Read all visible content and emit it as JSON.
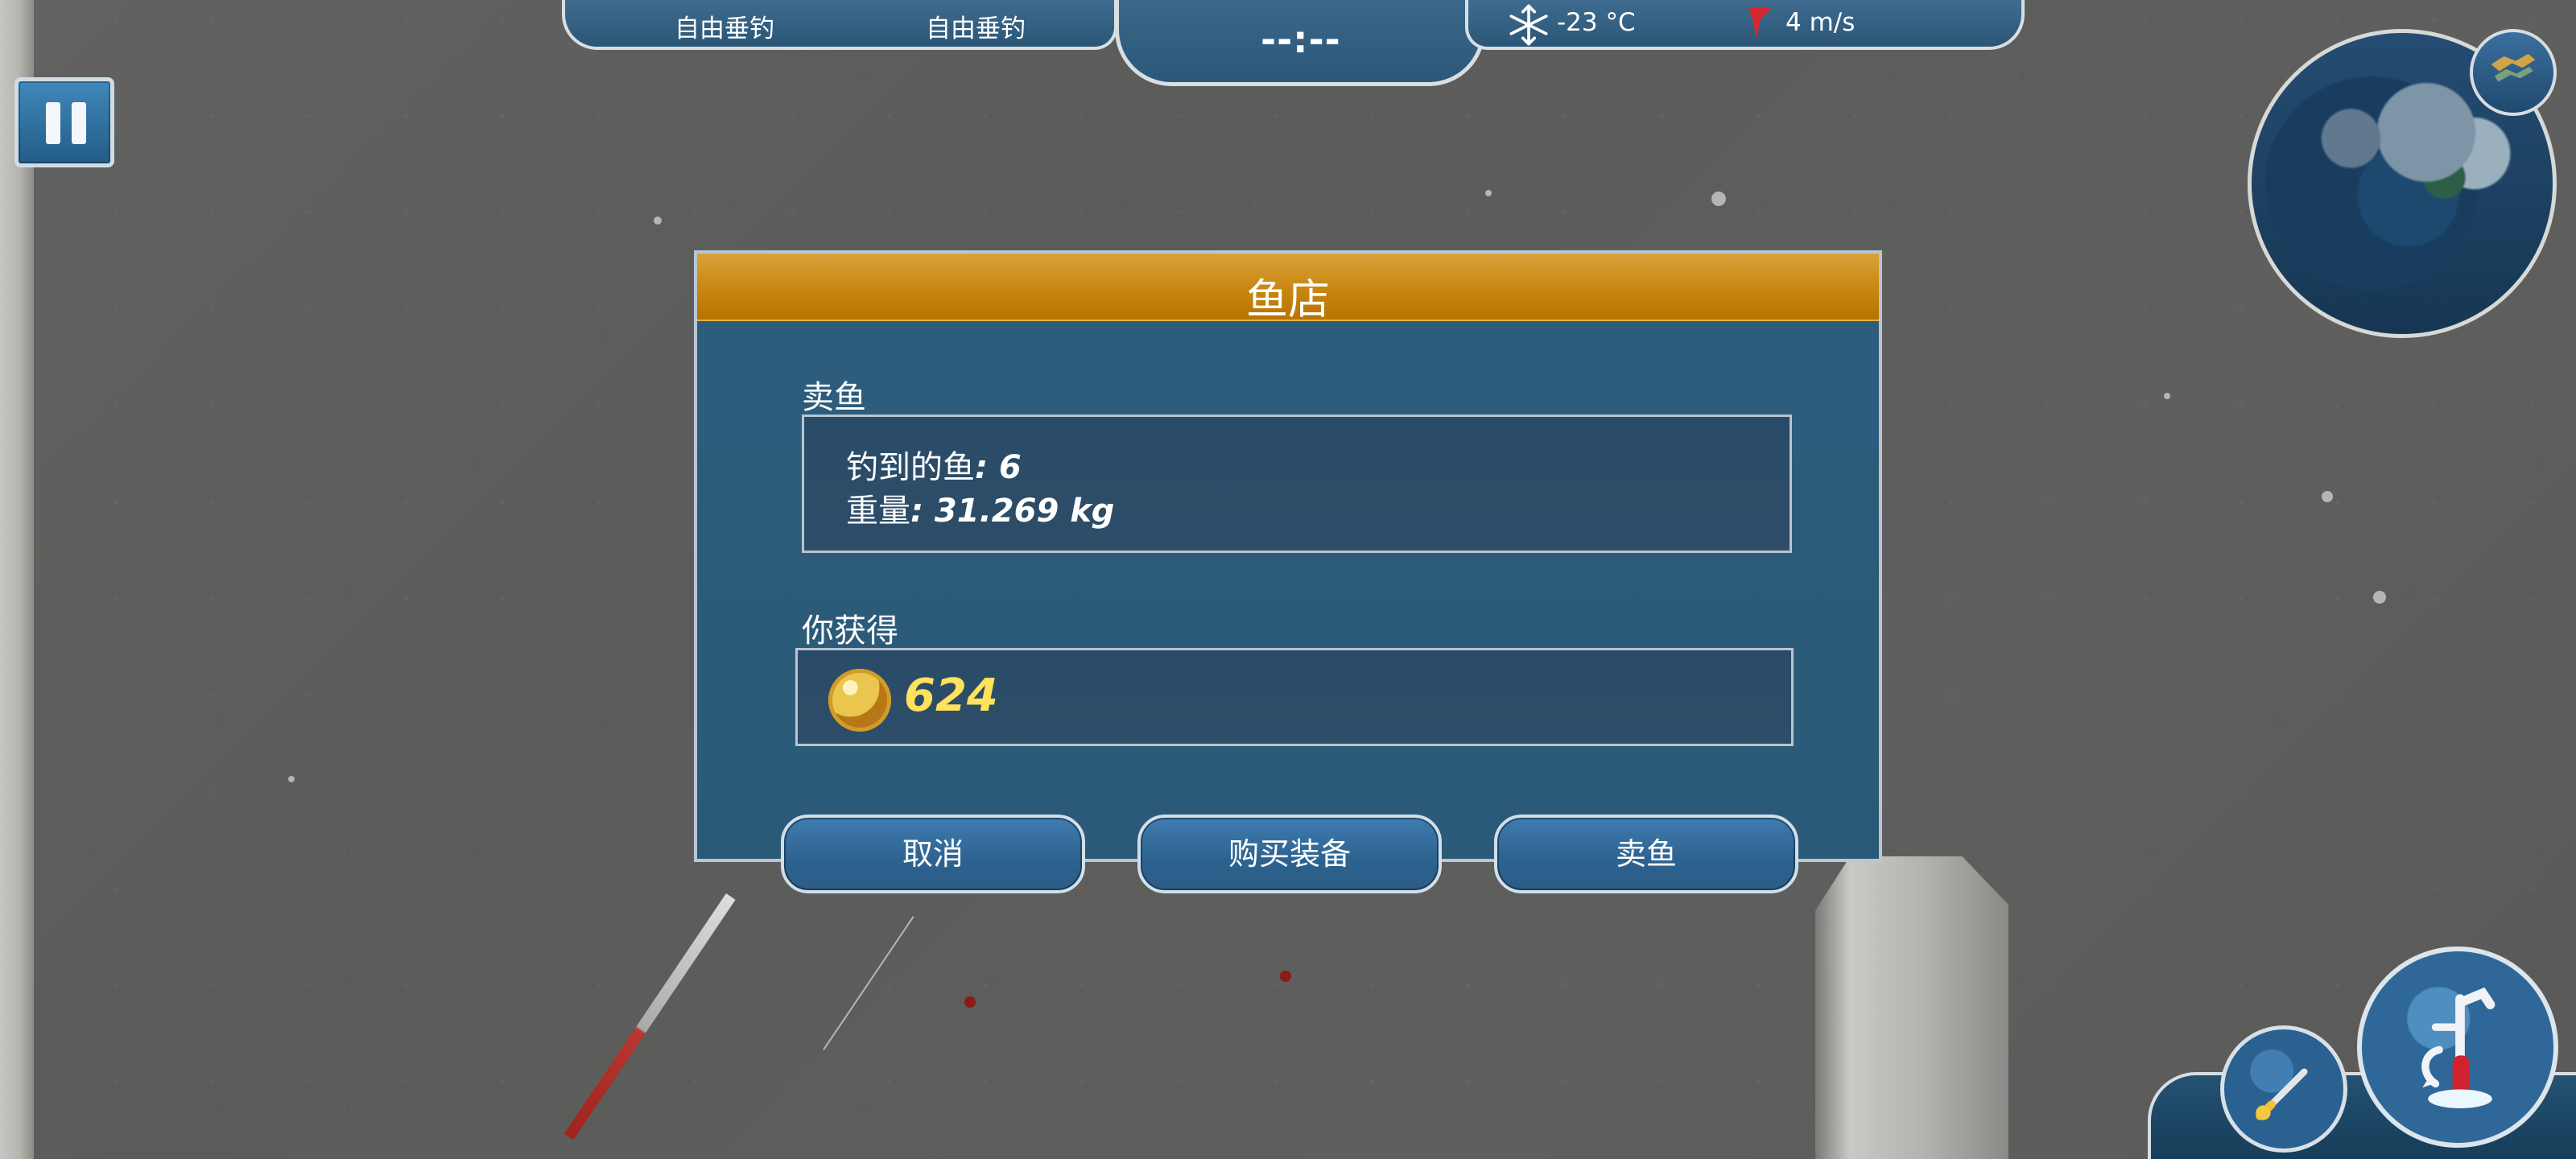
{
  "hud": {
    "mode_left": "自由垂钓",
    "mode_right": "自由垂钓",
    "clock": "--:--",
    "temperature": "-23 °C",
    "wind": "4 m/s",
    "snow_icon": "snowflake-icon",
    "wind_icon": "wind-arrow-icon"
  },
  "controls": {
    "pause_icon": "pause-icon",
    "map_icon": "map-icon",
    "small_tool_icon": "fishing-rod-icon",
    "large_tool_icon": "ice-drill-icon"
  },
  "dialog": {
    "title": "鱼店",
    "sell_section_label": "卖鱼",
    "fish_caught_label": "钓到的鱼",
    "fish_caught_value": ": 6",
    "weight_label": "重量",
    "weight_value": ": 31.269 kg",
    "earn_section_label": "你获得",
    "coin_icon": "coin-icon",
    "coin_value": "624",
    "buttons": {
      "cancel": "取消",
      "buy_equipment": "购买装备",
      "sell_fish": "卖鱼"
    }
  },
  "colors": {
    "header_gold": "#c88611",
    "panel_blue": "#2e5d7d",
    "button_blue": "#2d628f",
    "coin_text": "#ffe15c"
  }
}
